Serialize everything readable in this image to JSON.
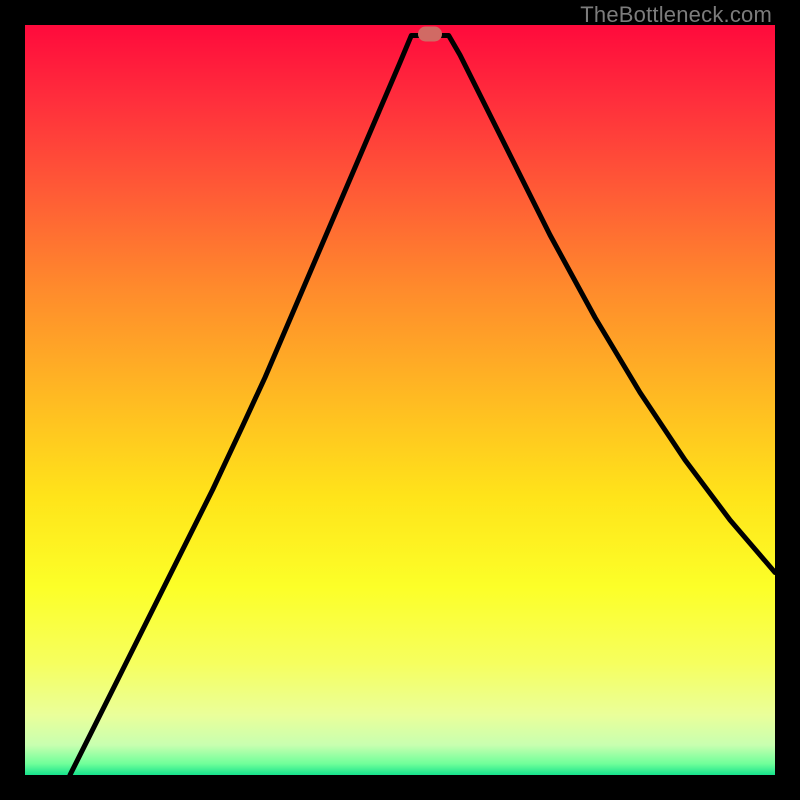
{
  "attribution": "TheBottleneck.com",
  "chart_data": {
    "type": "line",
    "title": "",
    "xlabel": "",
    "ylabel": "",
    "x_range": [
      0,
      100
    ],
    "y_range": [
      0,
      100
    ],
    "marker": {
      "x_pct": 54.0,
      "y_pct": 98.8
    },
    "series": [
      {
        "name": "bottleneck-curve",
        "points": [
          {
            "x_pct": 6.0,
            "y_pct": 0.0
          },
          {
            "x_pct": 12.5,
            "y_pct": 13.0
          },
          {
            "x_pct": 19.0,
            "y_pct": 26.0
          },
          {
            "x_pct": 25.0,
            "y_pct": 38.0
          },
          {
            "x_pct": 29.0,
            "y_pct": 46.5
          },
          {
            "x_pct": 32.0,
            "y_pct": 53.0
          },
          {
            "x_pct": 35.0,
            "y_pct": 60.0
          },
          {
            "x_pct": 38.0,
            "y_pct": 67.0
          },
          {
            "x_pct": 41.0,
            "y_pct": 74.0
          },
          {
            "x_pct": 44.0,
            "y_pct": 81.0
          },
          {
            "x_pct": 47.0,
            "y_pct": 88.0
          },
          {
            "x_pct": 50.0,
            "y_pct": 95.0
          },
          {
            "x_pct": 51.5,
            "y_pct": 98.6
          },
          {
            "x_pct": 56.5,
            "y_pct": 98.6
          },
          {
            "x_pct": 58.0,
            "y_pct": 96.0
          },
          {
            "x_pct": 61.0,
            "y_pct": 90.0
          },
          {
            "x_pct": 65.0,
            "y_pct": 82.0
          },
          {
            "x_pct": 70.0,
            "y_pct": 72.0
          },
          {
            "x_pct": 76.0,
            "y_pct": 61.0
          },
          {
            "x_pct": 82.0,
            "y_pct": 51.0
          },
          {
            "x_pct": 88.0,
            "y_pct": 42.0
          },
          {
            "x_pct": 94.0,
            "y_pct": 34.0
          },
          {
            "x_pct": 100.0,
            "y_pct": 27.0
          }
        ]
      }
    ]
  },
  "colors": {
    "curve_stroke": "#000000",
    "marker_fill": "#d16a64"
  }
}
